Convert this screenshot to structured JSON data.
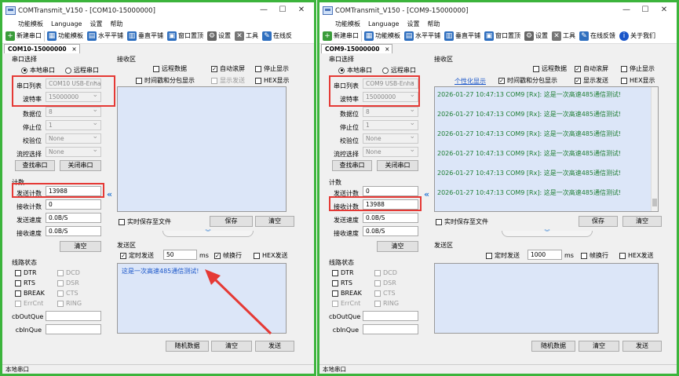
{
  "w1": {
    "title": "COMTransmit_V150 - [COM10-15000000]",
    "menus": [
      "功能模板",
      "Language",
      "设置",
      "帮助"
    ],
    "toolbar": [
      "新建串口",
      "功能模板",
      "水平平铺",
      "垂直平铺",
      "窗口置顶",
      "设置",
      "工具",
      "在线反"
    ],
    "tab": "COM10-15000000",
    "port_group": "串口选择",
    "local": "本地串口",
    "remote": "远程串口",
    "port_list_lbl": "串口列表",
    "port_list_val": "COM10  USB-Enha",
    "baud_lbl": "波特率",
    "baud_val": "15000000",
    "data_lbl": "数据位",
    "data_val": "8",
    "stop_lbl": "停止位",
    "stop_val": "1",
    "parity_lbl": "校验位",
    "parity_val": "None",
    "flow_lbl": "流控选择",
    "flow_val": "None",
    "find": "查找串口",
    "close": "关闭串口",
    "count_group": "计数",
    "sendcnt_lbl": "发送计数",
    "sendcnt_val": "13988",
    "recvcnt_lbl": "接收计数",
    "recvcnt_val": "0",
    "sendspd_lbl": "发送速度",
    "sendspd_val": "0.0B/S",
    "recvspd_lbl": "接收速度",
    "recvspd_val": "0.0B/S",
    "clear_cnt": "清空",
    "line_group": "线路状态",
    "lines": [
      "DTR",
      "DCD",
      "RTS",
      "DSR",
      "BREAK",
      "CTS",
      "ErrCnt",
      "RING"
    ],
    "cbout": "cbOutQue",
    "cbin": "cbInQue",
    "recv_group": "接收区",
    "remote_data": "远程数据",
    "auto_scroll": "自动滚屏",
    "stop_show": "停止显示",
    "timestamp": "时间戳和分包显示",
    "show_send": "显示发送",
    "hex_show": "HEX显示",
    "realtime_save": "实时保存至文件",
    "save": "保存",
    "clear_recv": "清空",
    "send_group": "发送区",
    "timed_send": "定时发送",
    "interval": "50",
    "ms": "ms",
    "newline": "帧换行",
    "hex_send": "HEX发送",
    "send_text": "这是一次高速485通信测试!",
    "random": "随机数据",
    "clear_send": "清空",
    "send": "发送",
    "status": "本地串口"
  },
  "w2": {
    "title": "COMTransmit_V150 - [COM9-15000000]",
    "menus": [
      "功能模板",
      "Language",
      "设置",
      "帮助"
    ],
    "toolbar": [
      "新建串口",
      "功能模板",
      "水平平铺",
      "垂直平铺",
      "窗口置顶",
      "设置",
      "工具",
      "在线反馈",
      "关于我们"
    ],
    "tab": "COM9-15000000",
    "port_group": "串口选择",
    "local": "本地串口",
    "remote": "远程串口",
    "port_list_lbl": "串口列表",
    "port_list_val": "COM9  USB-Enha",
    "baud_lbl": "波特率",
    "baud_val": "15000000",
    "data_lbl": "数据位",
    "data_val": "8",
    "stop_lbl": "停止位",
    "stop_val": "1",
    "parity_lbl": "校验位",
    "parity_val": "None",
    "flow_lbl": "流控选择",
    "flow_val": "None",
    "find": "查找串口",
    "close": "关闭串口",
    "count_group": "计数",
    "sendcnt_lbl": "发送计数",
    "sendcnt_val": "0",
    "recvcnt_lbl": "接收计数",
    "recvcnt_val": "13988",
    "sendspd_lbl": "发送速度",
    "sendspd_val": "0.0B/S",
    "recvspd_lbl": "接收速度",
    "recvspd_val": "0.0B/S",
    "clear_cnt": "清空",
    "line_group": "线路状态",
    "lines": [
      "DTR",
      "DCD",
      "RTS",
      "DSR",
      "BREAK",
      "CTS",
      "ErrCnt",
      "RING"
    ],
    "cbout": "cbOutQue",
    "cbin": "cbInQue",
    "recv_group": "接收区",
    "personal": "个性化显示",
    "remote_data": "远程数据",
    "auto_scroll": "自动滚屏",
    "stop_show": "停止显示",
    "timestamp": "时间戳和分包显示",
    "show_send": "显示发送",
    "hex_show": "HEX显示",
    "log": [
      "2026-01-27 10:47:13 COM9 [Rx]:  这是一次高速485通信测试!",
      "2026-01-27 10:47:13 COM9 [Rx]:  这是一次高速485通信测试!",
      "2026-01-27 10:47:13 COM9 [Rx]:  这是一次高速485通信测试!",
      "2026-01-27 10:47:13 COM9 [Rx]:  这是一次高速485通信测试!",
      "2026-01-27 10:47:13 COM9 [Rx]:  这是一次高速485通信测试!",
      "2026-01-27 10:47:13 COM9 [Rx]:  这是一次高速485通信测试!"
    ],
    "realtime_save": "实时保存至文件",
    "save": "保存",
    "clear_recv": "清空",
    "send_group": "发送区",
    "timed_send": "定时发送",
    "interval": "1000",
    "ms": "ms",
    "newline": "帧换行",
    "hex_send": "HEX发送",
    "random": "随机数据",
    "clear_send": "清空",
    "send": "发送",
    "status": "本地串口"
  }
}
